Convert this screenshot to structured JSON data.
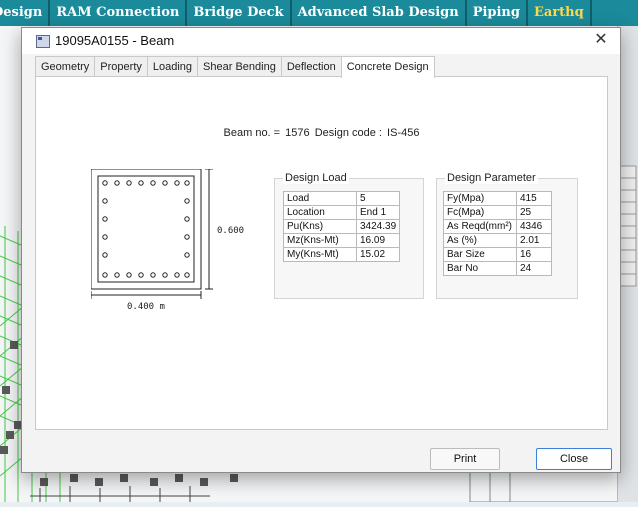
{
  "ribbon": {
    "tabs": [
      "Design",
      "RAM Connection",
      "Bridge Deck",
      "Advanced Slab Design",
      "Piping",
      "Earthq"
    ]
  },
  "dialog": {
    "title": "19095A0155 - Beam",
    "tabs": [
      "Geometry",
      "Property",
      "Loading",
      "Shear Bending",
      "Deflection",
      "Concrete Design"
    ],
    "active_tab": "Concrete Design",
    "beam_label": "Beam no. =",
    "beam_no": "1576",
    "code_label": "Design code :",
    "design_code": "IS-456",
    "section": {
      "depth_label": "0.600",
      "width_label": "0.400 m"
    },
    "design_load": {
      "title": "Design Load",
      "rows": [
        {
          "key": "Load",
          "value": "5"
        },
        {
          "key": "Location",
          "value": "End 1"
        },
        {
          "key": "Pu(Kns)",
          "value": "3424.39"
        },
        {
          "key": "Mz(Kns-Mt)",
          "value": "16.09"
        },
        {
          "key": "My(Kns-Mt)",
          "value": "15.02"
        }
      ]
    },
    "design_parameter": {
      "title": "Design Parameter",
      "rows": [
        {
          "key": "Fy(Mpa)",
          "value": "415"
        },
        {
          "key": "Fc(Mpa)",
          "value": "25"
        },
        {
          "key": "As Reqd(mm²)",
          "value": "4346"
        },
        {
          "key": "As (%)",
          "value": "2.01"
        },
        {
          "key": "Bar Size",
          "value": "16"
        },
        {
          "key": "Bar No",
          "value": "24"
        }
      ]
    },
    "buttons": {
      "print": "Print",
      "close": "Close"
    }
  },
  "colors": {
    "ribbon_bg": "#1b8a9a",
    "ribbon_text": "#ffffff",
    "accent": "#3c7fd8"
  }
}
